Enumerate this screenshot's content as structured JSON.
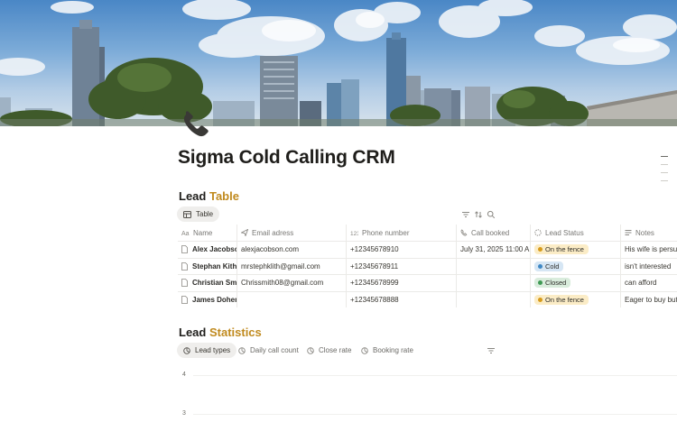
{
  "page": {
    "title": "Sigma Cold Calling CRM",
    "icon": "phone-icon"
  },
  "colors": {
    "accent": "#c08a1e",
    "pill_yellow": "#fbecc6",
    "pill_blue": "#d6e6f4",
    "pill_green": "#d9ecdc"
  },
  "lead_table": {
    "heading_plain": "Lead",
    "heading_accent": "Table",
    "view_tab": "Table",
    "toolbar_icons": [
      "filter-icon",
      "sort-icon",
      "search-icon"
    ],
    "columns": [
      {
        "label": "Name",
        "icon": "text-property-icon"
      },
      {
        "label": "Email adress",
        "icon": "email-property-icon"
      },
      {
        "label": "Phone number",
        "icon": "number-property-icon"
      },
      {
        "label": "Call booked",
        "icon": "phone-property-icon"
      },
      {
        "label": "Lead Status",
        "icon": "status-property-icon"
      },
      {
        "label": "Notes",
        "icon": "list-property-icon"
      }
    ],
    "rows": [
      {
        "name": "Alex Jacobson",
        "email": "alexjacobson.com",
        "phone": "+12345678910",
        "call_booked": "July 31, 2025 11:00 AM",
        "status": "On the fence",
        "status_color": "yellow",
        "notes": "His wife is persuad"
      },
      {
        "name": "Stephan Kith",
        "email": "mrstephklith@gmail.com",
        "phone": "+12345678911",
        "call_booked": "",
        "status": "Cold",
        "status_color": "blue",
        "notes": "isn't interested"
      },
      {
        "name": "Christian Smith",
        "email": "Chrissmith08@gmail.com",
        "phone": "+12345678999",
        "call_booked": "",
        "status": "Closed",
        "status_color": "green",
        "notes": "can afford"
      },
      {
        "name": "James Doherty",
        "email": "",
        "phone": "+12345678888",
        "call_booked": "",
        "status": "On the fence",
        "status_color": "yellow",
        "notes": "Eager to buy but h"
      }
    ]
  },
  "lead_statistics": {
    "heading_plain": "Lead",
    "heading_accent": "Statistics",
    "tabs": [
      "Lead types",
      "Daily call count",
      "Close rate",
      "Booking rate"
    ],
    "active_tab": "Lead types",
    "chart_axis_ticks": [
      "4",
      "3"
    ]
  }
}
